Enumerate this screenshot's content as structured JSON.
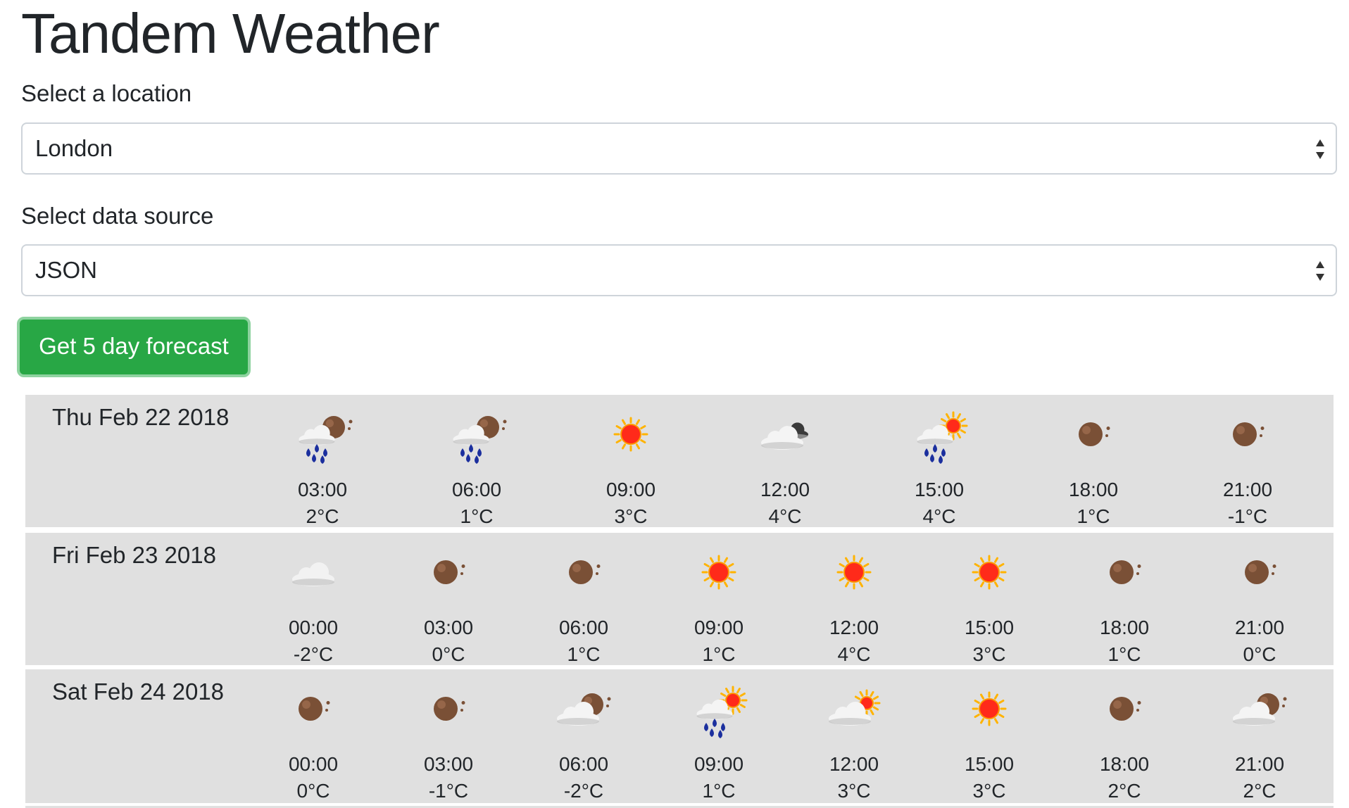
{
  "app": {
    "title": "Tandem Weather"
  },
  "location": {
    "label": "Select a location",
    "selected": "London"
  },
  "source": {
    "label": "Select data source",
    "selected": "JSON"
  },
  "action": {
    "button_label": "Get 5 day forecast"
  },
  "forecast": [
    {
      "date": "Thu Feb 22 2018",
      "slots": [
        {
          "time": "03:00",
          "temp": "2°C",
          "icon": "rain-night-icon"
        },
        {
          "time": "06:00",
          "temp": "1°C",
          "icon": "rain-night-icon"
        },
        {
          "time": "09:00",
          "temp": "3°C",
          "icon": "sun-icon"
        },
        {
          "time": "12:00",
          "temp": "4°C",
          "icon": "cloud-dark-icon"
        },
        {
          "time": "15:00",
          "temp": "4°C",
          "icon": "rain-sun-icon"
        },
        {
          "time": "18:00",
          "temp": "1°C",
          "icon": "moon-icon"
        },
        {
          "time": "21:00",
          "temp": "-1°C",
          "icon": "moon-icon"
        }
      ]
    },
    {
      "date": "Fri Feb 23 2018",
      "slots": [
        {
          "time": "00:00",
          "temp": "-2°C",
          "icon": "cloud-icon"
        },
        {
          "time": "03:00",
          "temp": "0°C",
          "icon": "moon-icon"
        },
        {
          "time": "06:00",
          "temp": "1°C",
          "icon": "moon-icon"
        },
        {
          "time": "09:00",
          "temp": "1°C",
          "icon": "sun-icon"
        },
        {
          "time": "12:00",
          "temp": "4°C",
          "icon": "sun-icon"
        },
        {
          "time": "15:00",
          "temp": "3°C",
          "icon": "sun-icon"
        },
        {
          "time": "18:00",
          "temp": "1°C",
          "icon": "moon-icon"
        },
        {
          "time": "21:00",
          "temp": "0°C",
          "icon": "moon-icon"
        }
      ]
    },
    {
      "date": "Sat Feb 24 2018",
      "slots": [
        {
          "time": "00:00",
          "temp": "0°C",
          "icon": "moon-icon"
        },
        {
          "time": "03:00",
          "temp": "-1°C",
          "icon": "moon-icon"
        },
        {
          "time": "06:00",
          "temp": "-2°C",
          "icon": "cloud-moon-icon"
        },
        {
          "time": "09:00",
          "temp": "1°C",
          "icon": "rain-sun-icon"
        },
        {
          "time": "12:00",
          "temp": "3°C",
          "icon": "cloud-sun-icon"
        },
        {
          "time": "15:00",
          "temp": "3°C",
          "icon": "sun-icon"
        },
        {
          "time": "18:00",
          "temp": "2°C",
          "icon": "moon-icon"
        },
        {
          "time": "21:00",
          "temp": "2°C",
          "icon": "cloud-moon-icon"
        }
      ]
    }
  ],
  "colors": {
    "button": "#28a745",
    "button_focus_ring": "#8fd3a0",
    "row_background": "#e0e0e0",
    "sun": "#ff2a1a",
    "moon": "#7a5036",
    "rain": "#1b2f9e"
  }
}
